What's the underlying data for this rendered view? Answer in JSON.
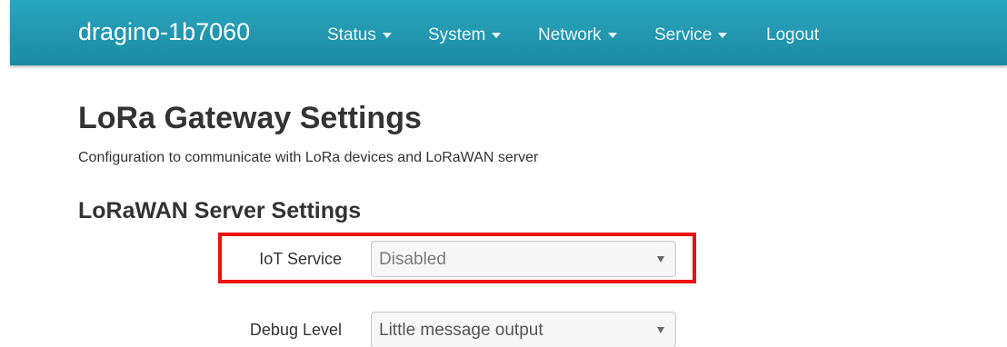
{
  "navbar": {
    "brand": "dragino-1b7060",
    "items": [
      {
        "label": "Status",
        "dropdown": true
      },
      {
        "label": "System",
        "dropdown": true
      },
      {
        "label": "Network",
        "dropdown": true
      },
      {
        "label": "Service",
        "dropdown": true
      },
      {
        "label": "Logout",
        "dropdown": false
      }
    ]
  },
  "page": {
    "title": "LoRa Gateway Settings",
    "description": "Configuration to communicate with LoRa devices and LoRaWAN server"
  },
  "section": {
    "title": "LoRaWAN Server Settings",
    "fields": [
      {
        "label": "IoT Service",
        "value": "Disabled"
      },
      {
        "label": "Debug Level",
        "value": "Little message output"
      }
    ]
  },
  "colors": {
    "navbar": "#1f93ab",
    "highlight": "#ee1111",
    "text": "#333333"
  }
}
